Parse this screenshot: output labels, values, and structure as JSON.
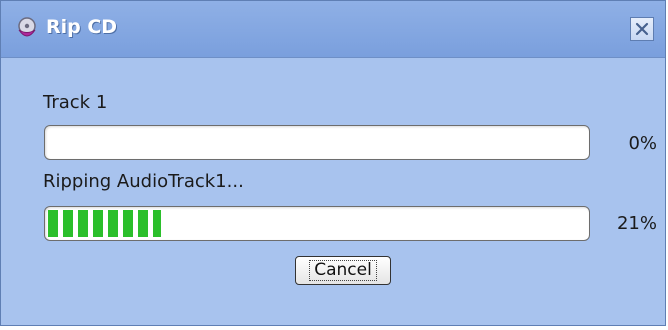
{
  "window": {
    "title": "Rip CD",
    "icons": {
      "app": "cd-rip-icon",
      "close": "close-icon"
    }
  },
  "track_progress": {
    "label": "Track 1",
    "percent_text": "0%",
    "value": 0
  },
  "rip_progress": {
    "label": "Ripping AudioTrack1...",
    "percent_text": "21%",
    "value": 0.21
  },
  "buttons": {
    "cancel": "Cancel"
  },
  "colors": {
    "progress_fill": "#2bbf2b",
    "dialog_bg": "#a8c3ee"
  }
}
